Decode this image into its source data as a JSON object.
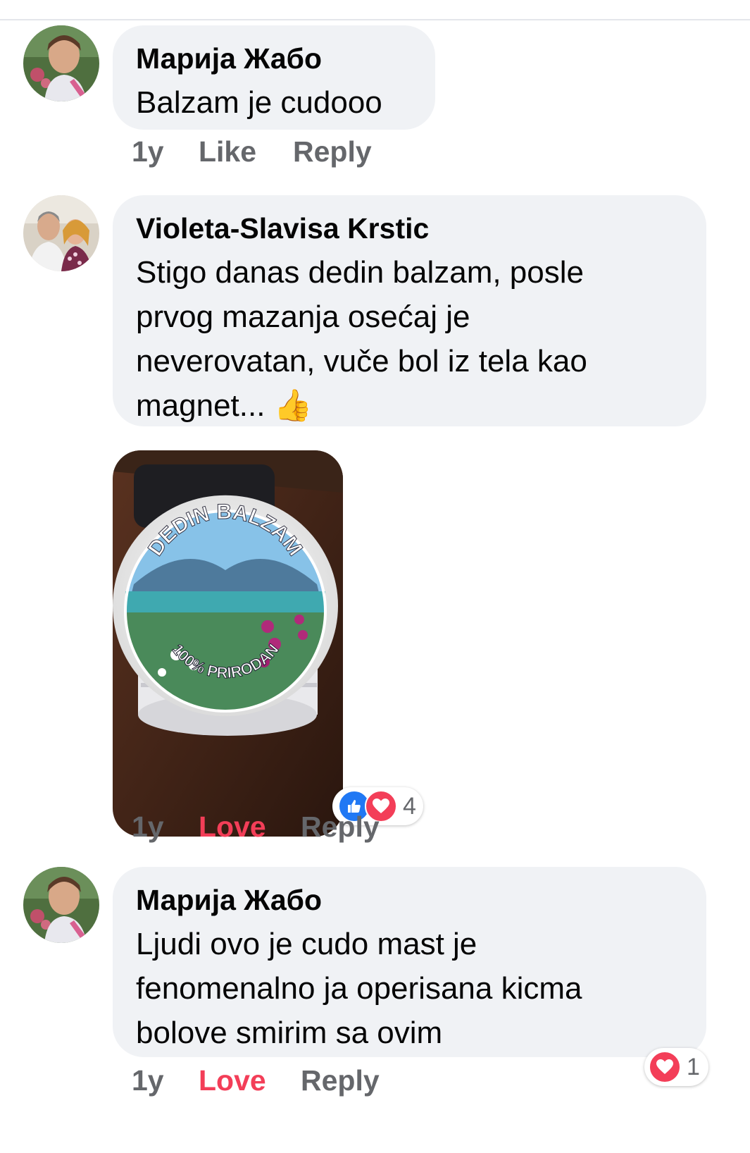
{
  "comments": [
    {
      "author": "Марија Жабо",
      "lines": [
        "Balzam je cudooo"
      ],
      "time": "1y",
      "react_label": "Like",
      "reply_label": "Reply",
      "avatar_icon": "profile-photo-woman-icon"
    },
    {
      "author": "Violeta-Slavisa Krstic",
      "lines": [
        "Stigo danas dedin balzam, posle",
        "prvog mazanja osećaj je",
        "neverovatan, vuče bol iz tela kao",
        "magnet... "
      ],
      "emoji": "👍",
      "time": "1y",
      "react_label": "Love",
      "reply_label": "Reply",
      "reaction_count": "4",
      "attachment": {
        "label_top": "DEDIN BALZAM",
        "label_bottom": "100% PRIRODAN"
      },
      "avatar_icon": "profile-photo-couple-icon"
    },
    {
      "author": "Марија Жабо",
      "lines": [
        "Ljudi ovo je cudo mast je",
        "fenomenalno ja operisana kicma",
        "bolove smirim sa ovim"
      ],
      "time": "1y",
      "react_label": "Love",
      "reply_label": "Reply",
      "reaction_count": "1",
      "avatar_icon": "profile-photo-woman-icon"
    }
  ],
  "colors": {
    "bubble": "#f0f2f5",
    "action_gray": "#65676b",
    "love_red": "#f33e58",
    "like_blue": "#2078f4"
  }
}
